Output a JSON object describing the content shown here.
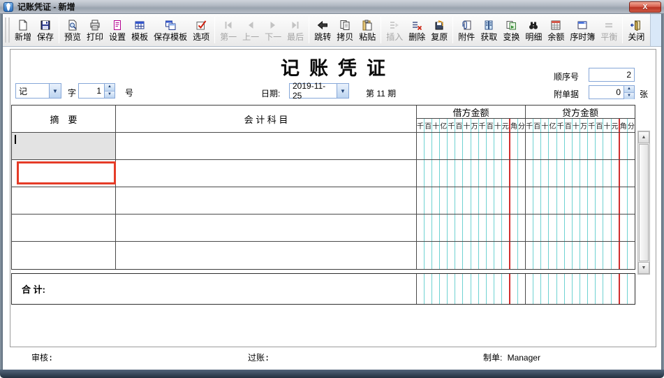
{
  "window": {
    "title": "记账凭证 - 新增",
    "close_glyph": "X"
  },
  "toolbar": {
    "groups": [
      {
        "items": [
          {
            "id": "new",
            "label": "新增",
            "icon": "new-page",
            "enabled": true
          },
          {
            "id": "save",
            "label": "保存",
            "icon": "save",
            "enabled": true
          }
        ]
      },
      {
        "items": [
          {
            "id": "preview",
            "label": "预览",
            "icon": "preview",
            "enabled": true
          },
          {
            "id": "print",
            "label": "打印",
            "icon": "print",
            "enabled": true
          },
          {
            "id": "setup",
            "label": "设置",
            "icon": "setup",
            "enabled": true
          },
          {
            "id": "template",
            "label": "模板",
            "icon": "template",
            "enabled": true
          },
          {
            "id": "save-template",
            "label": "保存模板",
            "icon": "save-template",
            "enabled": true
          },
          {
            "id": "options",
            "label": "选项",
            "icon": "options",
            "enabled": true
          }
        ]
      },
      {
        "items": [
          {
            "id": "first",
            "label": "第一",
            "icon": "nav-first",
            "enabled": false
          },
          {
            "id": "prev",
            "label": "上一",
            "icon": "nav-prev",
            "enabled": false
          },
          {
            "id": "next",
            "label": "下一",
            "icon": "nav-next",
            "enabled": false
          },
          {
            "id": "last",
            "label": "最后",
            "icon": "nav-last",
            "enabled": false
          }
        ]
      },
      {
        "items": [
          {
            "id": "jump",
            "label": "跳转",
            "icon": "jump",
            "enabled": true
          },
          {
            "id": "copy",
            "label": "拷贝",
            "icon": "copy",
            "enabled": true
          },
          {
            "id": "paste",
            "label": "粘贴",
            "icon": "paste",
            "enabled": true
          }
        ]
      },
      {
        "items": [
          {
            "id": "insert",
            "label": "插入",
            "icon": "insert",
            "enabled": false
          },
          {
            "id": "delete",
            "label": "删除",
            "icon": "delete",
            "enabled": true
          },
          {
            "id": "restore",
            "label": "复原",
            "icon": "restore",
            "enabled": true
          }
        ]
      },
      {
        "items": [
          {
            "id": "attach",
            "label": "附件",
            "icon": "attach",
            "enabled": true
          },
          {
            "id": "fetch",
            "label": "获取",
            "icon": "fetch",
            "enabled": true
          },
          {
            "id": "transform",
            "label": "变换",
            "icon": "transform",
            "enabled": true
          },
          {
            "id": "detail",
            "label": "明细",
            "icon": "detail",
            "enabled": true
          },
          {
            "id": "balance",
            "label": "余额",
            "icon": "balance",
            "enabled": true
          },
          {
            "id": "journal",
            "label": "序时簿",
            "icon": "journal",
            "enabled": true
          },
          {
            "id": "equal",
            "label": "平衡",
            "icon": "equal",
            "enabled": false
          }
        ]
      },
      {
        "items": [
          {
            "id": "close",
            "label": "关闭",
            "icon": "close-door",
            "enabled": true
          }
        ]
      }
    ]
  },
  "voucher": {
    "title": "记账凭证",
    "seq_label": "顺序号",
    "seq_value": "2",
    "attach_label": "附单据",
    "attach_value": "0",
    "attach_unit": "张",
    "word_value": "记",
    "word_suffix": "字",
    "number_value": "1",
    "number_suffix": "号",
    "date_label": "日期:",
    "date_value": "2019-11-25",
    "period_text": "第 11 期",
    "table": {
      "summary_header": "摘　要",
      "account_header": "会 计 科 目",
      "debit_header": "借方金额",
      "credit_header": "贷方金额",
      "digit_headers": [
        "千",
        "百",
        "十",
        "亿",
        "千",
        "百",
        "十",
        "万",
        "千",
        "百",
        "十",
        "元",
        "角",
        "分"
      ],
      "body_row_count": 5,
      "total_label": "合  计:"
    },
    "footer": {
      "reviewer_label": "审核:",
      "posted_label": "过账:",
      "preparer_label": "制单:",
      "preparer_value": "Manager"
    }
  },
  "colors": {
    "selection_red": "#e53c28",
    "grid_cyan": "#6fd2d2",
    "decimal_red_line": "#cf2f2f",
    "toolbar_fill_blue": "#d9e8f8"
  }
}
